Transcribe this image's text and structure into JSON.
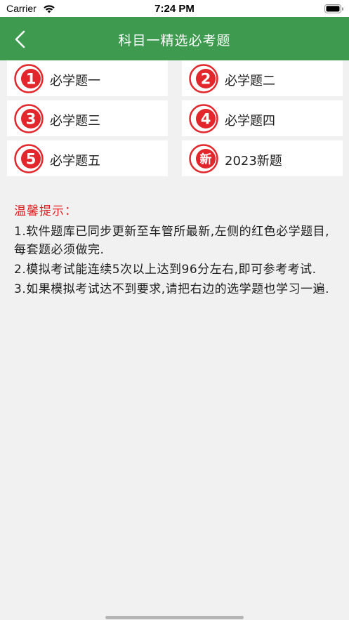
{
  "status_bar": {
    "carrier": "Carrier",
    "time": "7:24 PM"
  },
  "nav": {
    "title": "科目一精选必考题"
  },
  "colors": {
    "nav_green": "#3d9a4f",
    "badge_red": "#e2262b",
    "tip_red": "#e02222"
  },
  "grid": {
    "items": [
      {
        "badge": "1",
        "label": "必学题一",
        "icon": "number-badge-icon"
      },
      {
        "badge": "2",
        "label": "必学题二",
        "icon": "number-badge-icon"
      },
      {
        "badge": "3",
        "label": "必学题三",
        "icon": "number-badge-icon"
      },
      {
        "badge": "4",
        "label": "必学题四",
        "icon": "number-badge-icon"
      },
      {
        "badge": "5",
        "label": "必学题五",
        "icon": "number-badge-icon"
      },
      {
        "badge": "新",
        "label": "2023新题",
        "icon": "new-badge-icon"
      }
    ]
  },
  "tips": {
    "title": "温馨提示：",
    "lines": [
      "1.软件题库已同步更新至车管所最新,左侧的红色必学题目,每套题必须做完.",
      "2.模拟考试能连续5次以上达到96分左右,即可参考考试.",
      "3.如果模拟考试达不到要求,请把右边的选学题也学习一遍."
    ]
  }
}
